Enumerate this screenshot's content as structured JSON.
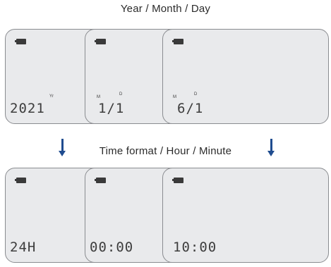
{
  "captions": {
    "top": "Year / Month / Day",
    "middle": "Time format / Hour / Minute"
  },
  "icons": {
    "battery": "battery-icon",
    "arrow": "arrow-down-icon"
  },
  "colors": {
    "panel_background": "#e9eaec",
    "panel_border": "#8a8c90",
    "arrow": "#1f4c8f"
  },
  "screens": {
    "year": {
      "readout": "2021",
      "tag": "Yr"
    },
    "month": {
      "readout": "1/1",
      "month_tag": "M",
      "day_tag": "D"
    },
    "day": {
      "readout": "6/1",
      "month_tag": "M",
      "day_tag": "D"
    },
    "time_format": {
      "readout": "24H"
    },
    "hour": {
      "readout": "00:00"
    },
    "minute": {
      "readout": "10:00"
    }
  }
}
